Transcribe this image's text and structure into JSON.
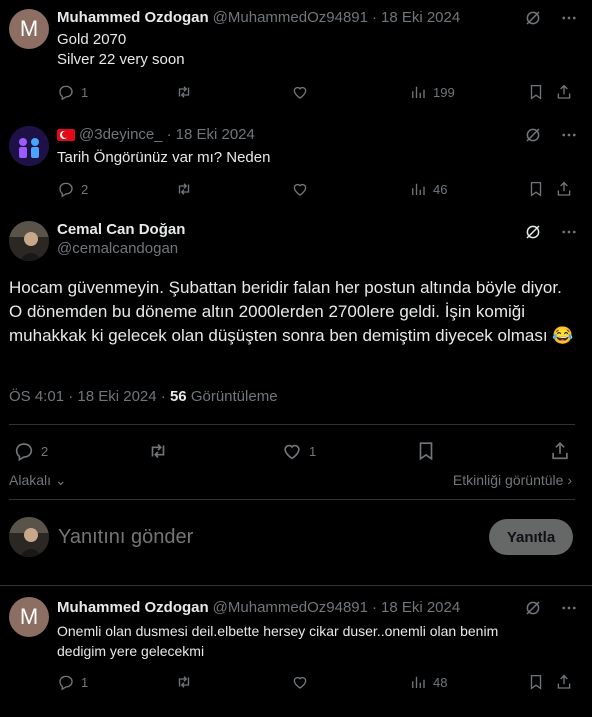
{
  "post1": {
    "avatar_letter": "M",
    "name": "Muhammed Ozdogan",
    "handle": "@MuhammedOz94891",
    "date": "18 Eki 2024",
    "line1": "Gold 2070",
    "line2": "Silver 22 very soon",
    "replies": "1",
    "views": "199"
  },
  "post2": {
    "handle": "@3deyince_",
    "date": "18 Eki 2024",
    "text": "Tarih Öngörünüz var mı? Neden",
    "replies": "2",
    "views": "46"
  },
  "main": {
    "name": "Cemal Can Doğan",
    "handle": "@cemalcandogan",
    "text": "Hocam güvenmeyin. Şubattan beridir falan her postun altında böyle diyor. O dönemden bu döneme altın 2000lerden 2700lere geldi. İşin komiği muhakkak ki gelecek olan düşüşten sonra ben demiştim diyecek olması 😂",
    "time": "ÖS 4:01",
    "date": "18 Eki 2024",
    "views_count": "56",
    "views_label": "Görüntüleme",
    "replies": "2",
    "likes": "1",
    "relevant_label": "Alakalı",
    "engagement_label": "Etkinliği görüntüle"
  },
  "composer": {
    "placeholder": "Yanıtını gönder",
    "button": "Yanıtla"
  },
  "post3": {
    "avatar_letter": "M",
    "name": "Muhammed Ozdogan",
    "handle": "@MuhammedOz94891",
    "date": "18 Eki 2024",
    "line1": "Onemli olan dusmesi deil.elbette hersey cikar duser..onemli olan benim",
    "line2": "dedigim yere gelecekmi",
    "replies": "1",
    "views": "48"
  },
  "colors": {
    "background": "#000000",
    "text": "#e7e9ea",
    "muted": "#71767b",
    "divider": "#2f3336"
  }
}
